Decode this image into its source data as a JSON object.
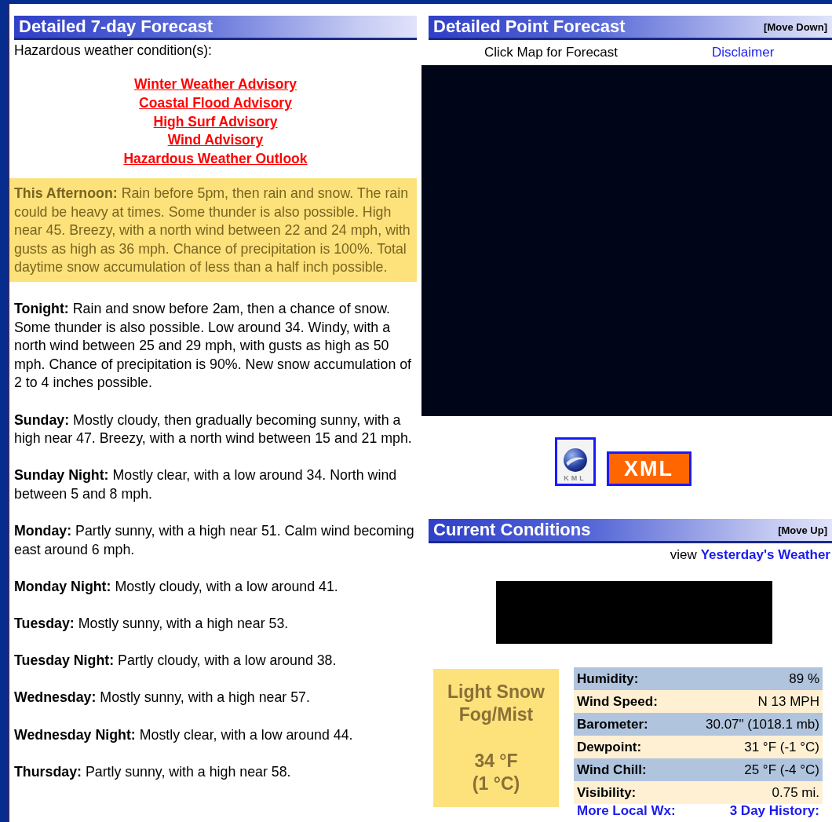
{
  "forecast": {
    "title": "Detailed 7-day Forecast",
    "hazard_label": "Hazardous weather condition(s):",
    "hazards": [
      "Winter Weather Advisory",
      "Coastal Flood Advisory",
      "High Surf Advisory",
      "Wind Advisory",
      "Hazardous Weather Outlook"
    ],
    "periods": [
      {
        "name": "This Afternoon:",
        "text": "Rain before 5pm, then rain and snow. The rain could be heavy at times. Some thunder is also possible. High near 45. Breezy, with a north wind between 22 and 24 mph, with gusts as high as 36 mph. Chance of precipitation is 100%. Total daytime snow accumulation of less than a half inch possible.",
        "highlighted": true
      },
      {
        "name": "Tonight:",
        "text": "Rain and snow before 2am, then a chance of snow. Some thunder is also possible. Low around 34. Windy, with a north wind between 25 and 29 mph, with gusts as high as 50 mph. Chance of precipitation is 90%. New snow accumulation of 2 to 4 inches possible.",
        "highlighted": false
      },
      {
        "name": "Sunday:",
        "text": "Mostly cloudy, then gradually becoming sunny, with a high near 47. Breezy, with a north wind between 15 and 21 mph.",
        "highlighted": false
      },
      {
        "name": "Sunday Night:",
        "text": "Mostly clear, with a low around 34. North wind between 5 and 8 mph.",
        "highlighted": false
      },
      {
        "name": "Monday:",
        "text": "Partly sunny, with a high near 51. Calm wind becoming east around 6 mph.",
        "highlighted": false
      },
      {
        "name": "Monday Night:",
        "text": "Mostly cloudy, with a low around 41.",
        "highlighted": false
      },
      {
        "name": "Tuesday:",
        "text": "Mostly sunny, with a high near 53.",
        "highlighted": false
      },
      {
        "name": "Tuesday Night:",
        "text": "Partly cloudy, with a low around 38.",
        "highlighted": false
      },
      {
        "name": "Wednesday:",
        "text": "Mostly sunny, with a high near 57.",
        "highlighted": false
      },
      {
        "name": "Wednesday Night:",
        "text": "Mostly clear, with a low around 44.",
        "highlighted": false
      },
      {
        "name": "Thursday:",
        "text": "Partly sunny, with a high near 58.",
        "highlighted": false
      }
    ]
  },
  "point_forecast": {
    "title": "Detailed Point Forecast",
    "move": "[Move Down]",
    "map_hint": "Click Map for Forecast",
    "disclaimer": "Disclaimer",
    "kml_label": "KML",
    "xml_label": "XML"
  },
  "current": {
    "title": "Current Conditions",
    "move": "[Move Up]",
    "view_label": "view",
    "yesterday_link": "Yesterday's Weather",
    "summary": [
      "Light Snow",
      "Fog/Mist"
    ],
    "temp_f": "34 °F",
    "temp_c": "(1 °C)",
    "rows": [
      {
        "label": "Humidity:",
        "value": "89 %"
      },
      {
        "label": "Wind Speed:",
        "value": "N 13 MPH"
      },
      {
        "label": "Barometer:",
        "value": "30.07\" (1018.1 mb)"
      },
      {
        "label": "Dewpoint:",
        "value": "31 °F (-1 °C)"
      },
      {
        "label": "Wind Chill:",
        "value": "25 °F (-4 °C)"
      },
      {
        "label": "Visibility:",
        "value": "0.75 mi."
      }
    ],
    "links": [
      "More Local Wx:",
      "3 Day History:"
    ]
  }
}
